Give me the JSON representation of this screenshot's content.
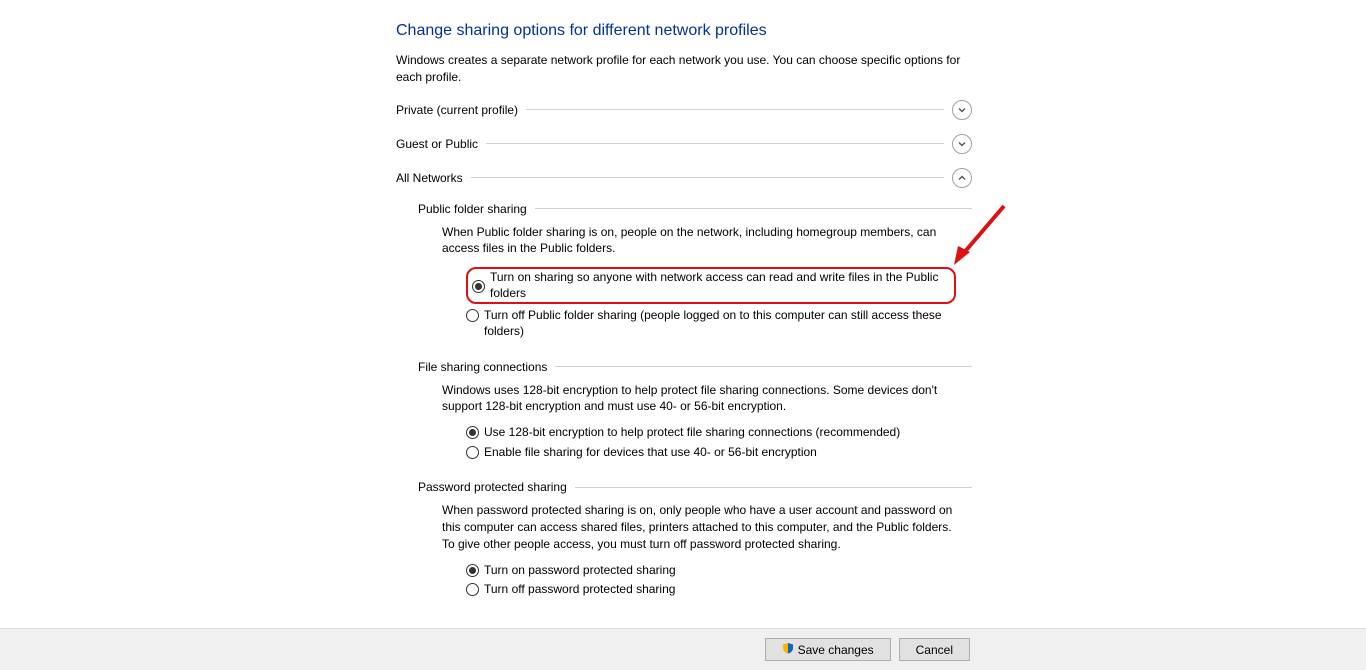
{
  "title": "Change sharing options for different network profiles",
  "subtitle": "Windows creates a separate network profile for each network you use. You can choose specific options for each profile.",
  "profiles": {
    "private": {
      "label": "Private (current profile)",
      "expanded": false
    },
    "guest": {
      "label": "Guest or Public",
      "expanded": false
    },
    "all": {
      "label": "All Networks",
      "expanded": true
    }
  },
  "publicFolder": {
    "heading": "Public folder sharing",
    "desc": "When Public folder sharing is on, people on the network, including homegroup members, can access files in the Public folders.",
    "opts": {
      "on": "Turn on sharing so anyone with network access can read and write files in the Public folders",
      "off": "Turn off Public folder sharing (people logged on to this computer can still access these folders)"
    },
    "selected": "on"
  },
  "fileConn": {
    "heading": "File sharing connections",
    "desc": "Windows uses 128-bit encryption to help protect file sharing connections. Some devices don't support 128-bit encryption and must use 40- or 56-bit encryption.",
    "opts": {
      "strong": "Use 128-bit encryption to help protect file sharing connections (recommended)",
      "weak": "Enable file sharing for devices that use 40- or 56-bit encryption"
    },
    "selected": "strong"
  },
  "password": {
    "heading": "Password protected sharing",
    "desc": "When password protected sharing is on, only people who have a user account and password on this computer can access shared files, printers attached to this computer, and the Public folders. To give other people access, you must turn off password protected sharing.",
    "opts": {
      "on": "Turn on password protected sharing",
      "off": "Turn off password protected sharing"
    },
    "selected": "on"
  },
  "buttons": {
    "save": "Save changes",
    "cancel": "Cancel"
  }
}
